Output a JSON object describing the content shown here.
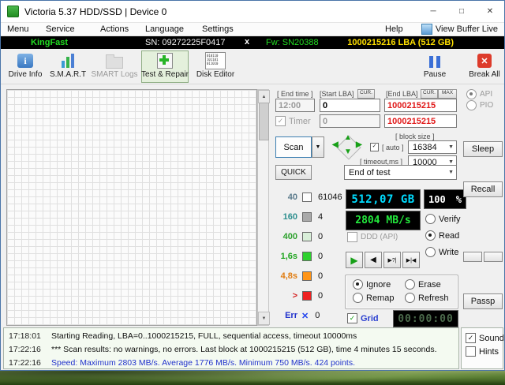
{
  "window": {
    "title": "Victoria 5.37 HDD/SSD | Device 0"
  },
  "icons": {
    "minimize": "─",
    "maximize": "□",
    "close": "✕",
    "scroll_up": "▲",
    "scroll_down": "▼",
    "dropdown": "▼",
    "check": "✓",
    "pad_up": "▲",
    "pad_down": "▼",
    "pad_left": "◀",
    "pad_right": "▶",
    "play": "▶",
    "step_back": "◀",
    "skip_bad": "▶?|",
    "skip_end": "▶|◀",
    "err_cross": "✕",
    "info_i": "i",
    "break_cross": "✕",
    "editor_lines": [
      "010110",
      "101101",
      "011010"
    ]
  },
  "menu": {
    "items": [
      "Menu",
      "Service",
      "Actions",
      "Language",
      "Settings",
      "Help"
    ],
    "view_buffer_live": "View Buffer Live"
  },
  "device_bar": {
    "model": "KingFast",
    "serial": "SN: 09272225F0417",
    "x_button": "x",
    "firmware": "Fw: SN20388",
    "capacity": "1000215216 LBA (512 GB)"
  },
  "toolbar": {
    "drive_info": "Drive Info",
    "smart": "S.M.A.R.T",
    "smart_logs": "SMART Logs",
    "test_repair": "Test & Repair",
    "disk_editor": "Disk Editor",
    "pause": "Pause",
    "break_all": "Break All"
  },
  "test_controls": {
    "end_time_label": "[ End time ]",
    "end_time_value": "12:00",
    "start_lba_label": "[Start LBA]",
    "cur_button": "CUR.",
    "end_lba_label": "[End LBA]",
    "max_button": "MAX",
    "start_lba_value": "0",
    "end_lba_value": "1000215215",
    "timer_label": "Timer",
    "timer_row_start": "0",
    "timer_row_end": "1000215215",
    "scan_button": "Scan",
    "block_size_label": "[ block size ]",
    "auto_label": "[ auto ]",
    "block_size_value": "16384",
    "timeout_label": "[ timeout,ms ]",
    "timeout_value": "10000",
    "quick_button": "QUICK",
    "end_of_test": "End of test"
  },
  "legend": {
    "rows": [
      {
        "label": "40",
        "count": "61046",
        "label_color": "#5b7b8c",
        "block_color": "#fdfdfd"
      },
      {
        "label": "160",
        "count": "4",
        "label_color": "#2e8f8f",
        "block_color": "#a9a9a9"
      },
      {
        "label": "400",
        "count": "0",
        "label_color": "#2da12d",
        "block_color": "#d9efd9"
      },
      {
        "label": "1,6s",
        "count": "0",
        "label_color": "#1fa51f",
        "block_color": "#2fd12f"
      },
      {
        "label": "4,8s",
        "count": "0",
        "label_color": "#e07d12",
        "block_color": "#ff9416"
      },
      {
        "label": ">",
        "count": "0",
        "label_color": "#d42222",
        "block_color": "#ee2222"
      },
      {
        "label": "Err",
        "count": "0",
        "label_color": "#2233cc",
        "block_color": "#2244ee"
      }
    ]
  },
  "displays": {
    "capacity": "512,07 GB",
    "capacity_color": "#00dcff",
    "progress": "100",
    "percent": "%",
    "speed": "2804 MB/s",
    "speed_color": "#23e83c",
    "timer": "00:00:00",
    "timer_color": "#4c6b4c"
  },
  "modes": {
    "ddd": "DDD (API)",
    "verify": "Verify",
    "read": "Read",
    "write": "Write"
  },
  "actions": {
    "ignore": "Ignore",
    "erase": "Erase",
    "remap": "Remap",
    "refresh": "Refresh"
  },
  "grid_toggle": {
    "label": "Grid"
  },
  "side_panel": {
    "api": "API",
    "pio": "PIO",
    "sleep": "Sleep",
    "recall": "Recall",
    "passp": "Passp",
    "sound": "Sound",
    "hints": "Hints"
  },
  "log": {
    "entries": [
      {
        "time": "17:18:01",
        "message": "Starting Reading, LBA=0..1000215215, FULL, sequential access, timeout 10000ms",
        "color": "#101010"
      },
      {
        "time": "17:22:16",
        "message": "*** Scan results: no warnings, no errors. Last block at 1000215215 (512 GB), time 4 minutes 15 seconds.",
        "color": "#101010"
      },
      {
        "time": "17:22:16",
        "message": "Speed: Maximum 2803 MB/s. Average 1776 MB/s. Minimum 750 MB/s. 424 points.",
        "color": "#2233cc"
      }
    ]
  }
}
